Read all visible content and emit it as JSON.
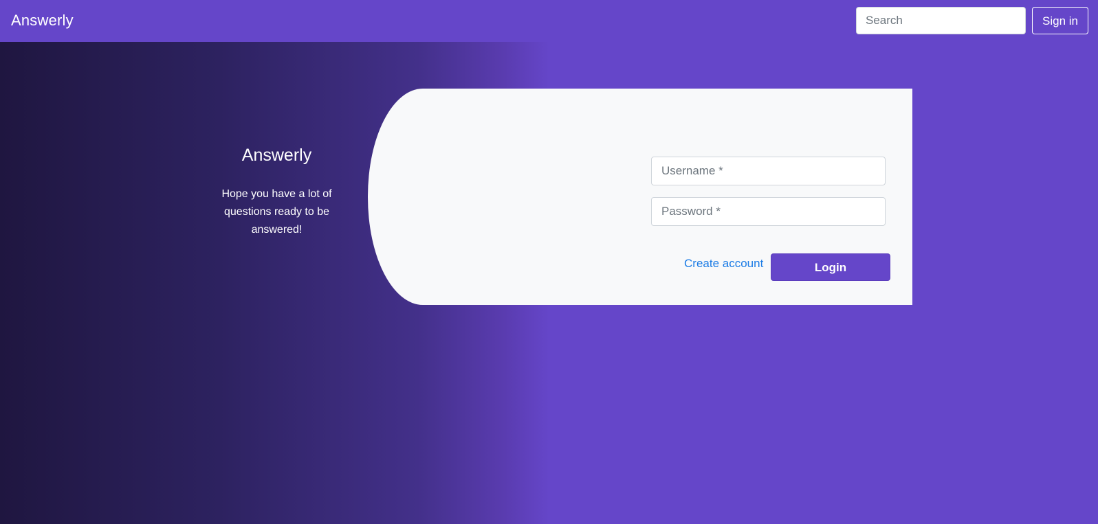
{
  "navbar": {
    "brand": "Answerly",
    "search_placeholder": "Search",
    "signin_label": "Sign in"
  },
  "intro": {
    "title": "Answerly",
    "text": "Hope you have a lot of questions ready to be answered!"
  },
  "login_form": {
    "username_placeholder": "Username *",
    "password_placeholder": "Password *",
    "create_account_label": "Create account",
    "login_label": "Login"
  },
  "colors": {
    "brand_purple": "#6546c9",
    "gradient_dark": "#1f1640",
    "card_background": "#f8f9fa",
    "link_blue": "#1a7be5"
  }
}
